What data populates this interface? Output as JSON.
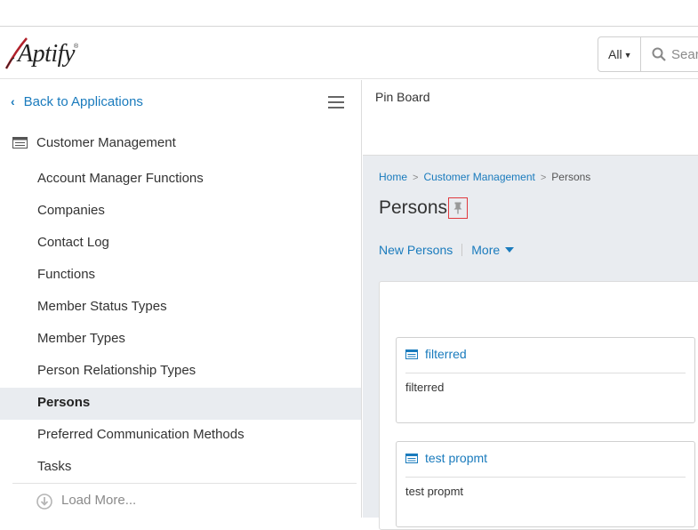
{
  "header": {
    "logo_text": "Aptify",
    "search": {
      "scope": "All",
      "placeholder": "Sear"
    }
  },
  "sidebar": {
    "back_label": "Back to Applications",
    "group_label": "Customer Management",
    "items": [
      {
        "label": "Account Manager Functions"
      },
      {
        "label": "Companies"
      },
      {
        "label": "Contact Log"
      },
      {
        "label": "Functions"
      },
      {
        "label": "Member Status Types"
      },
      {
        "label": "Member Types"
      },
      {
        "label": "Person Relationship Types"
      },
      {
        "label": "Persons"
      },
      {
        "label": "Preferred Communication Methods"
      },
      {
        "label": "Tasks"
      }
    ],
    "active_item": "Persons",
    "load_more": "Load More..."
  },
  "main": {
    "pinboard_title": "Pin Board",
    "breadcrumb": [
      "Home",
      "Customer Management",
      "Persons"
    ],
    "page_title": "Persons",
    "actions": {
      "new": "New Persons",
      "more": "More"
    },
    "cards": [
      {
        "title": "filterred",
        "body": "filterred"
      },
      {
        "title": "test propmt",
        "body": "test propmt"
      }
    ]
  },
  "colors": {
    "link": "#1a7bbd",
    "active_bg": "#e9ecf0",
    "pin_highlight": "#e0393e"
  }
}
